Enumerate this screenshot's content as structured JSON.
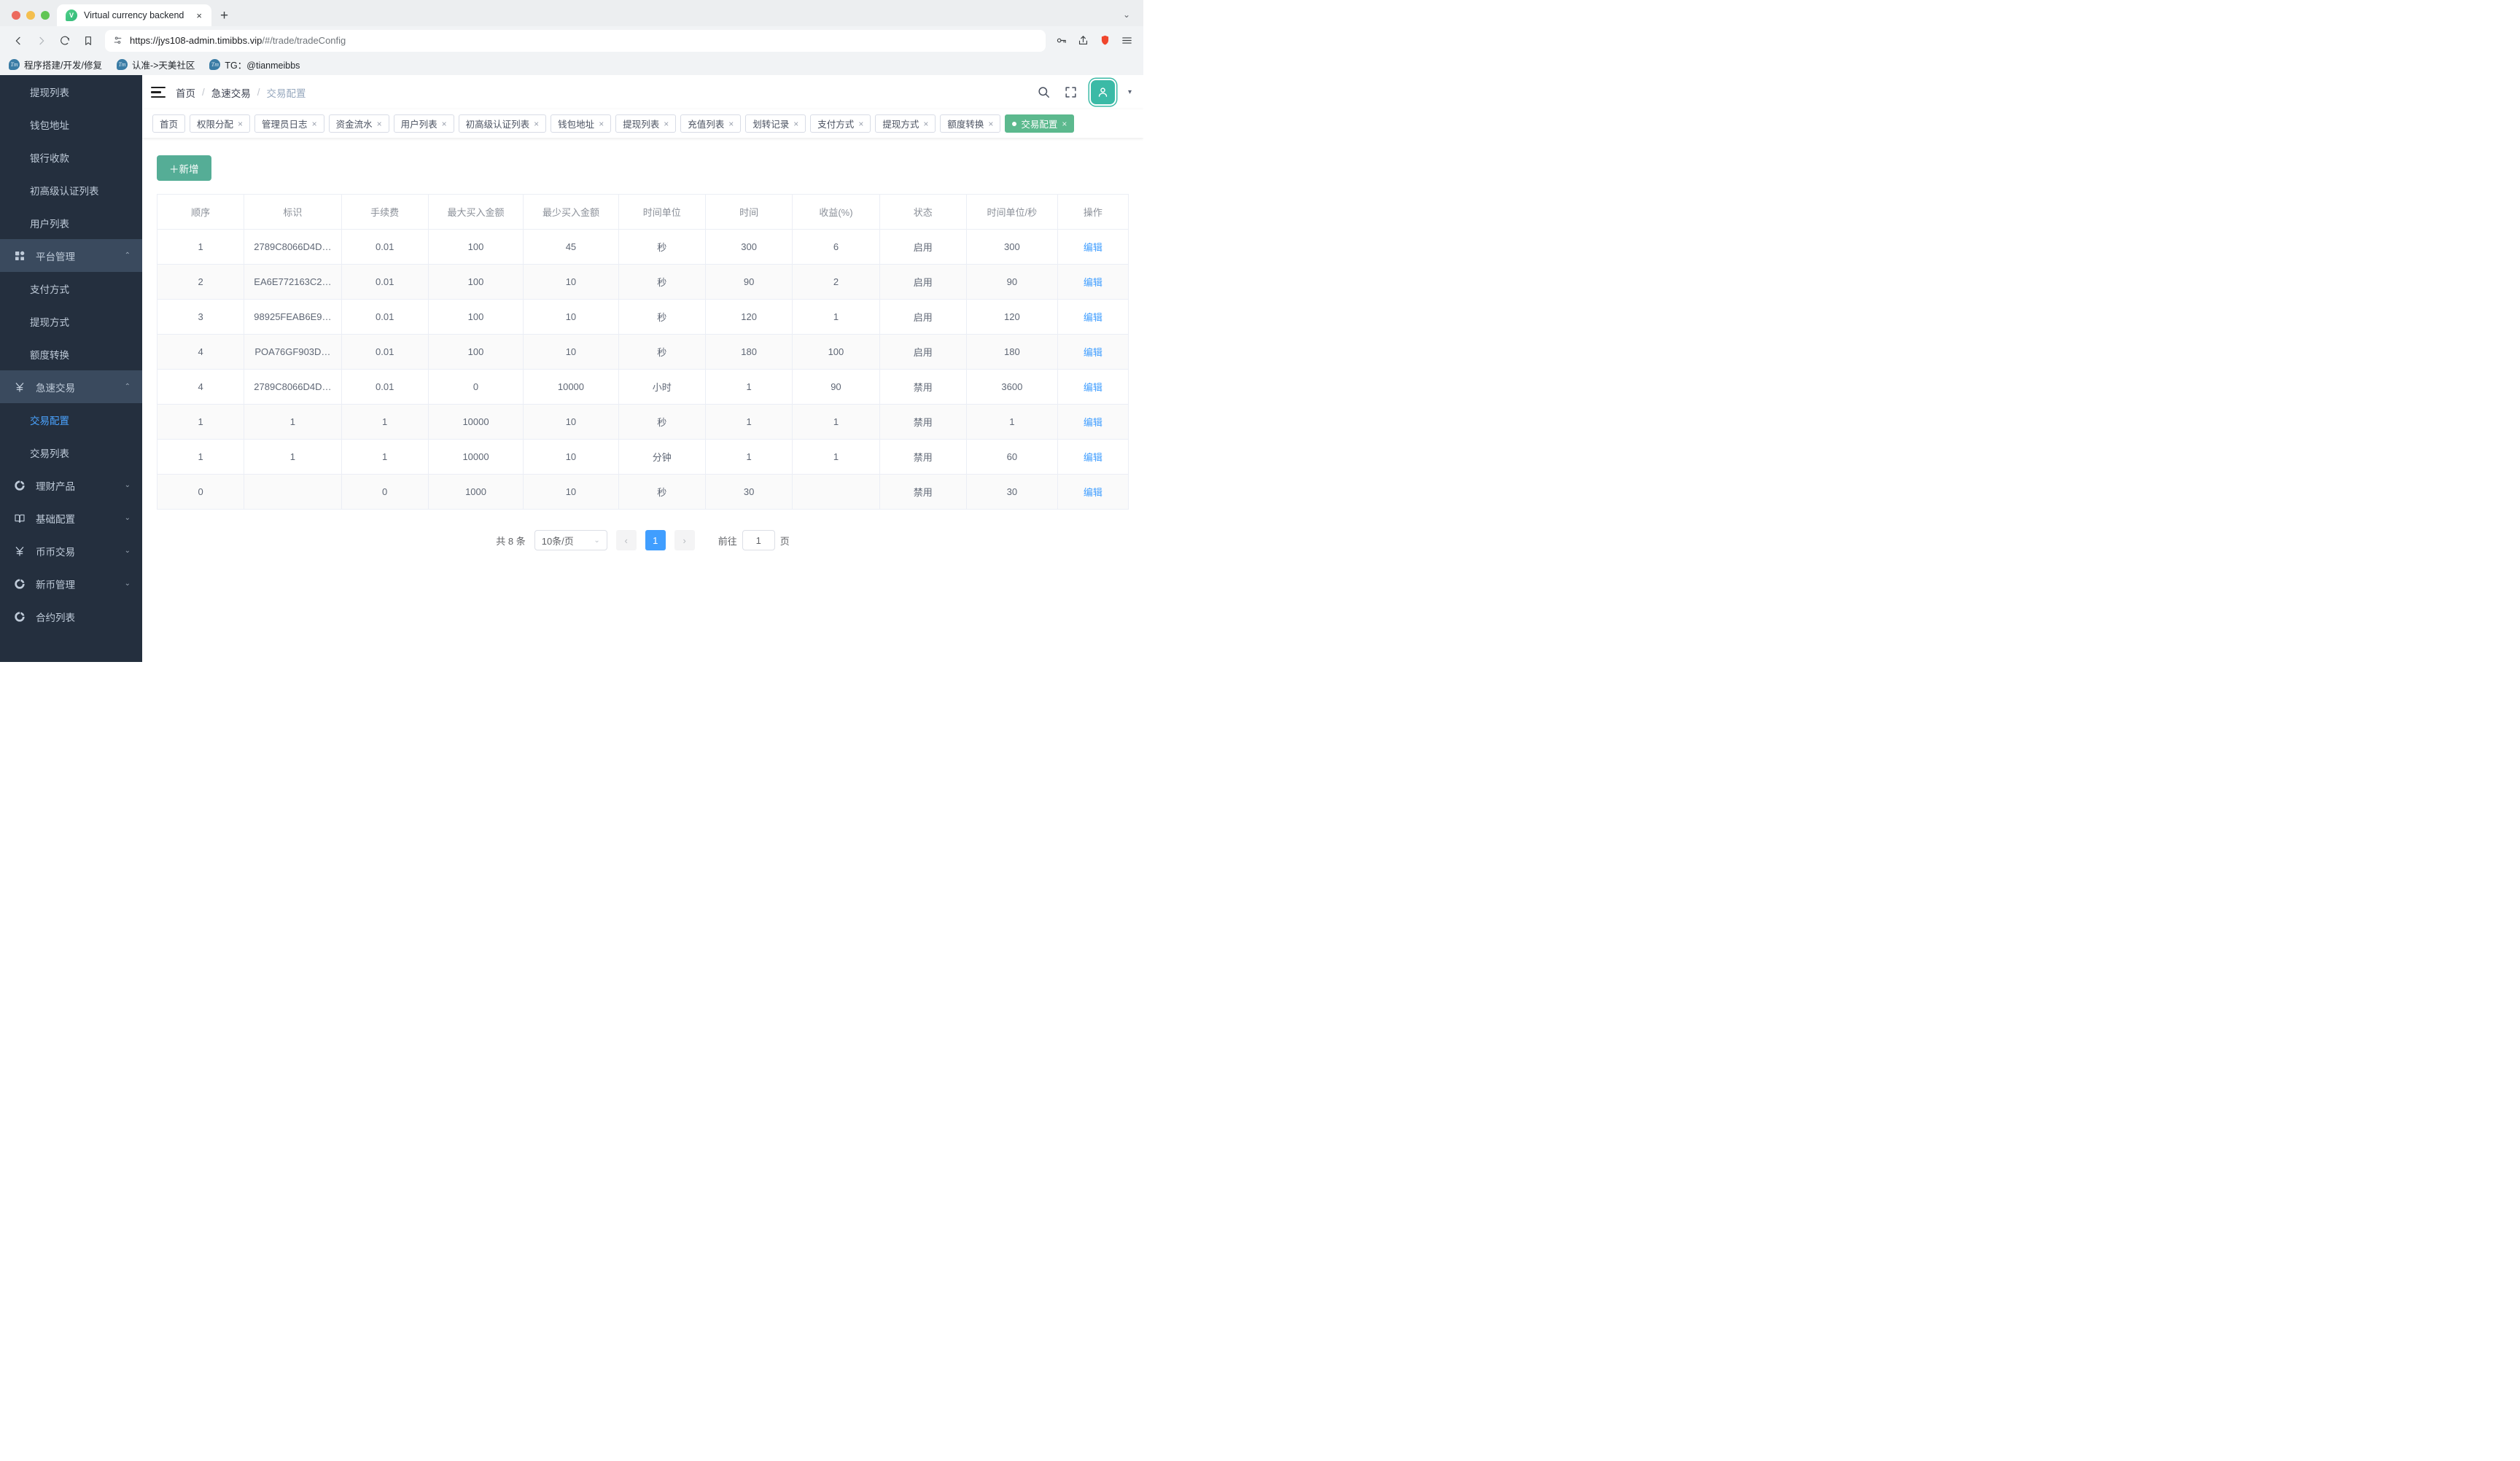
{
  "browser": {
    "tab_title": "Virtual currency backend",
    "favicon_letter": "V",
    "new_tab_label": "+",
    "close_tab_label": "×",
    "tablist_caret": "⌄",
    "url_host": "https://jys108-admin.timibbs.vip",
    "url_path": "/#/trade/tradeConfig",
    "bookmarks": [
      {
        "label": "程序搭建/开发/修复",
        "icon_letter": "Tm"
      },
      {
        "label": "认准->天美社区",
        "icon_letter": "Tm"
      },
      {
        "label": "TG：@tianmeibbs",
        "icon_letter": "Tm"
      }
    ]
  },
  "sidebar": {
    "items": [
      {
        "label": "提现列表",
        "type": "sub",
        "active": false
      },
      {
        "label": "钱包地址",
        "type": "sub",
        "active": false
      },
      {
        "label": "银行收款",
        "type": "sub",
        "active": false
      },
      {
        "label": "初高级认证列表",
        "type": "sub",
        "active": false
      },
      {
        "label": "用户列表",
        "type": "sub",
        "active": false
      },
      {
        "label": "平台管理",
        "type": "group",
        "icon": "grid-icon",
        "highlight": true,
        "arrow": "⌃"
      },
      {
        "label": "支付方式",
        "type": "sub",
        "active": false
      },
      {
        "label": "提现方式",
        "type": "sub",
        "active": false
      },
      {
        "label": "额度转换",
        "type": "sub",
        "active": false
      },
      {
        "label": "急速交易",
        "type": "group",
        "icon": "yen-icon",
        "highlight": true,
        "arrow": "⌃"
      },
      {
        "label": "交易配置",
        "type": "sub",
        "active": true
      },
      {
        "label": "交易列表",
        "type": "sub",
        "active": false
      },
      {
        "label": "理财产品",
        "type": "group",
        "icon": "donut-icon",
        "highlight": false,
        "arrow": "⌄"
      },
      {
        "label": "基础配置",
        "type": "group",
        "icon": "book-icon",
        "highlight": false,
        "arrow": "⌄"
      },
      {
        "label": "币币交易",
        "type": "group",
        "icon": "yen-icon",
        "highlight": false,
        "arrow": "⌄"
      },
      {
        "label": "新币管理",
        "type": "group",
        "icon": "donut-icon",
        "highlight": false,
        "arrow": "⌄"
      },
      {
        "label": "合约列表",
        "type": "group",
        "icon": "donut-icon",
        "highlight": false,
        "arrow": ""
      }
    ]
  },
  "topbar": {
    "menu_icon": "hamburger-icon",
    "breadcrumb": [
      "首页",
      "急速交易",
      "交易配置"
    ],
    "separator": "/",
    "icons": [
      "search-icon",
      "fullscreen-icon",
      "user-avatar-icon",
      "chevron-down-icon"
    ]
  },
  "tagbar": {
    "tags": [
      {
        "label": "首页",
        "closable": false,
        "active": false
      },
      {
        "label": "权限分配",
        "closable": true,
        "active": false
      },
      {
        "label": "管理员日志",
        "closable": true,
        "active": false
      },
      {
        "label": "资金流水",
        "closable": true,
        "active": false
      },
      {
        "label": "用户列表",
        "closable": true,
        "active": false
      },
      {
        "label": "初高级认证列表",
        "closable": true,
        "active": false
      },
      {
        "label": "钱包地址",
        "closable": true,
        "active": false
      },
      {
        "label": "提现列表",
        "closable": true,
        "active": false
      },
      {
        "label": "充值列表",
        "closable": true,
        "active": false
      },
      {
        "label": "划转记录",
        "closable": true,
        "active": false
      },
      {
        "label": "支付方式",
        "closable": true,
        "active": false
      },
      {
        "label": "提现方式",
        "closable": true,
        "active": false
      },
      {
        "label": "额度转换",
        "closable": true,
        "active": false
      },
      {
        "label": "交易配置",
        "closable": true,
        "active": true
      }
    ],
    "close_glyph": "×"
  },
  "toolbar": {
    "add_label": "＋新增"
  },
  "table": {
    "columns": [
      "顺序",
      "标识",
      "手续费",
      "最大买入金额",
      "最少买入金额",
      "时间单位",
      "时间",
      "收益(%)",
      "状态",
      "时间单位/秒",
      "操作"
    ],
    "rows": [
      {
        "cells": [
          "1",
          "2789C8066D4D…",
          "0.01",
          "100",
          "45",
          "秒",
          "300",
          "6"
        ],
        "status": "启用",
        "status_type": "enabled",
        "unit_sec": "300",
        "action": "编辑"
      },
      {
        "cells": [
          "2",
          "EA6E772163C2…",
          "0.01",
          "100",
          "10",
          "秒",
          "90",
          "2"
        ],
        "status": "启用",
        "status_type": "enabled",
        "unit_sec": "90",
        "action": "编辑"
      },
      {
        "cells": [
          "3",
          "98925FEAB6E9…",
          "0.01",
          "100",
          "10",
          "秒",
          "120",
          "1"
        ],
        "status": "启用",
        "status_type": "enabled",
        "unit_sec": "120",
        "action": "编辑"
      },
      {
        "cells": [
          "4",
          "POA76GF903D…",
          "0.01",
          "100",
          "10",
          "秒",
          "180",
          "100"
        ],
        "status": "启用",
        "status_type": "enabled",
        "unit_sec": "180",
        "action": "编辑"
      },
      {
        "cells": [
          "4",
          "2789C8066D4D…",
          "0.01",
          "0",
          "10000",
          "小时",
          "1",
          "90"
        ],
        "status": "禁用",
        "status_type": "disabled",
        "unit_sec": "3600",
        "action": "编辑"
      },
      {
        "cells": [
          "1",
          "1",
          "1",
          "10000",
          "10",
          "秒",
          "1",
          "1"
        ],
        "status": "禁用",
        "status_type": "disabled",
        "unit_sec": "1",
        "action": "编辑"
      },
      {
        "cells": [
          "1",
          "1",
          "1",
          "10000",
          "10",
          "分钟",
          "1",
          "1"
        ],
        "status": "禁用",
        "status_type": "disabled",
        "unit_sec": "60",
        "action": "编辑"
      },
      {
        "cells": [
          "0",
          "",
          "0",
          "1000",
          "10",
          "秒",
          "30",
          ""
        ],
        "status": "禁用",
        "status_type": "disabled",
        "unit_sec": "30",
        "action": "编辑"
      }
    ]
  },
  "pagination": {
    "total_text": "共 8 条",
    "page_size": "10条/页",
    "prev": "‹",
    "next": "›",
    "current_page": "1",
    "jump_prefix": "前往",
    "jump_value": "1",
    "jump_suffix": "页"
  },
  "colors": {
    "accent_green": "#55ad96",
    "sidebar_bg": "#242f3e",
    "active_tab": "#5cb98e",
    "link_blue": "#409eff",
    "enabled": "#67c23a",
    "disabled": "#f56c6c"
  }
}
